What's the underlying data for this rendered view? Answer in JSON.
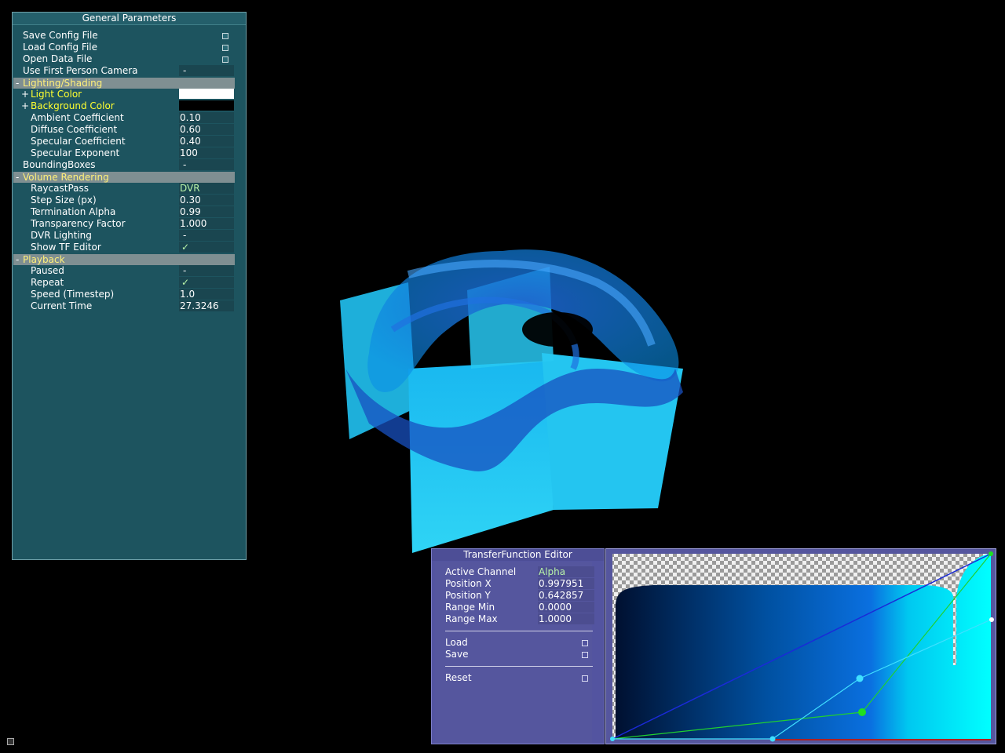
{
  "general_parameters": {
    "title": "General Parameters",
    "actions": [
      {
        "label": "Save Config File"
      },
      {
        "label": "Load Config File"
      },
      {
        "label": "Open Data File"
      }
    ],
    "use_first_person_camera": {
      "label": "Use First Person Camera",
      "value": "-"
    },
    "lighting": {
      "group_label": "Lighting/Shading",
      "toggle": "-",
      "light_color": {
        "label": "Light Color",
        "value": "#ffffff",
        "expander": "+"
      },
      "background_color": {
        "label": "Background Color",
        "value": "#000000",
        "expander": "+"
      },
      "ambient": {
        "label": "Ambient Coefficient",
        "value": "0.10"
      },
      "diffuse": {
        "label": "Diffuse Coefficient",
        "value": "0.60"
      },
      "specular": {
        "label": "Specular Coefficient",
        "value": "0.40"
      },
      "exponent": {
        "label": "Specular Exponent",
        "value": "100"
      }
    },
    "bounding_boxes": {
      "label": "BoundingBoxes",
      "value": "-"
    },
    "volume": {
      "group_label": "Volume Rendering",
      "toggle": "-",
      "raycast_pass": {
        "label": "RaycastPass",
        "value": "DVR"
      },
      "step_size": {
        "label": "Step Size (px)",
        "value": "0.30"
      },
      "termination_alpha": {
        "label": "Termination Alpha",
        "value": "0.99"
      },
      "transparency": {
        "label": "Transparency Factor",
        "value": "1.000"
      },
      "dvr_lighting": {
        "label": "DVR Lighting",
        "value": "-"
      },
      "show_tf_editor": {
        "label": "Show TF Editor",
        "value": "✓"
      }
    },
    "playback": {
      "group_label": "Playback",
      "toggle": "-",
      "paused": {
        "label": "Paused",
        "value": "-"
      },
      "repeat": {
        "label": "Repeat",
        "value": "✓"
      },
      "speed": {
        "label": "Speed (Timestep)",
        "value": "1.0"
      },
      "current_time": {
        "label": "Current Time",
        "value": "27.3246"
      }
    }
  },
  "tf_editor": {
    "title": "TransferFunction Editor",
    "active_channel": {
      "label": "Active Channel",
      "value": "Alpha"
    },
    "position_x": {
      "label": "Position X",
      "value": "0.997951"
    },
    "position_y": {
      "label": "Position Y",
      "value": "0.642857"
    },
    "range_min": {
      "label": "Range Min",
      "value": "0.0000"
    },
    "range_max": {
      "label": "Range Max",
      "value": "1.0000"
    },
    "load_label": "Load",
    "save_label": "Save",
    "reset_label": "Reset"
  },
  "colors": {
    "panel_bg": "#1d545f",
    "group_header": "#7f8f92",
    "group_text": "#fff07a",
    "tf_panel_bg": "#5354a0",
    "volume_cyan": "#00c8ff",
    "volume_blue": "#1060d0"
  }
}
